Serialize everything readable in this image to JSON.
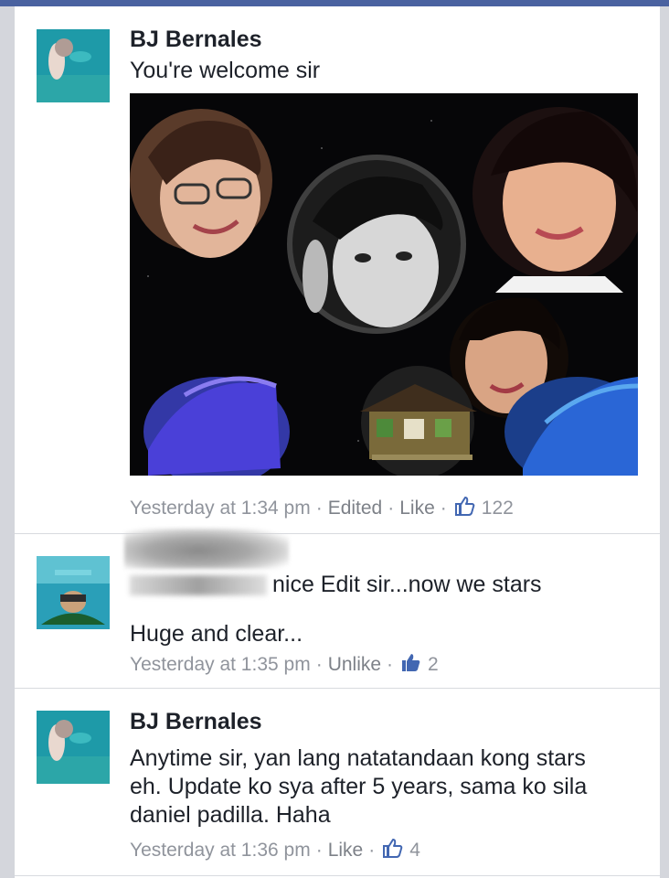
{
  "comments": [
    {
      "author": "BJ Bernales",
      "text": "You're welcome sir",
      "meta": {
        "time": "Yesterday at 1:34 pm",
        "edited": "Edited",
        "action": "Like",
        "likes": "122"
      }
    },
    {
      "author": "",
      "mention_visible": "nice Edit sir...now we stars",
      "text_line2": "Huge and clear...",
      "meta": {
        "time": "Yesterday at 1:35 pm",
        "action": "Unlike",
        "likes": "2"
      }
    },
    {
      "author": "BJ Bernales",
      "text": "Anytime sir, yan lang natatandaan kong stars eh. Update ko sya after 5 years, sama ko sila daniel padilla. Haha",
      "meta": {
        "time": "Yesterday at 1:36 pm",
        "action": "Like",
        "likes": "4"
      }
    }
  ],
  "colors": {
    "top_bar": "#4a62a0",
    "like_blue": "#4267b2",
    "meta_gray": "#90949c"
  },
  "icons": {
    "like": "thumbs-up-icon"
  }
}
